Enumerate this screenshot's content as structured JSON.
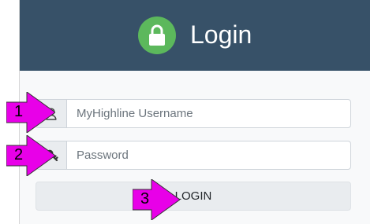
{
  "header": {
    "title": "Login",
    "lock_icon": "lock-icon",
    "background_color": "#375168",
    "lock_circle_color": "#5cb85c"
  },
  "form": {
    "username": {
      "placeholder": "MyHighline Username",
      "value": "",
      "icon": "user-icon"
    },
    "password": {
      "placeholder": "Password",
      "value": "",
      "icon": "key-icon"
    },
    "login_button_label": "LOGIN"
  },
  "callouts": {
    "color": "#e800e8",
    "items": [
      "1",
      "2",
      "3"
    ]
  }
}
